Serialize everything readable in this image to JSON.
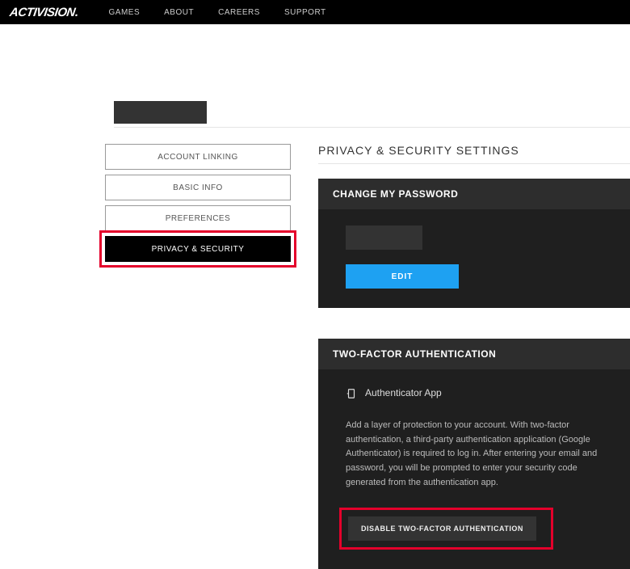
{
  "header": {
    "logo": "ACTIVISION",
    "nav": [
      "GAMES",
      "ABOUT",
      "CAREERS",
      "SUPPORT"
    ]
  },
  "sidenav": {
    "items": [
      {
        "label": "ACCOUNT LINKING",
        "active": false
      },
      {
        "label": "BASIC INFO",
        "active": false
      },
      {
        "label": "PREFERENCES",
        "active": false
      },
      {
        "label": "PRIVACY & SECURITY",
        "active": true
      }
    ]
  },
  "main": {
    "title": "PRIVACY & SECURITY SETTINGS",
    "password_card": {
      "header": "CHANGE MY PASSWORD",
      "edit_label": "EDIT"
    },
    "tfa_card": {
      "header": "TWO-FACTOR AUTHENTICATION",
      "app_label": "Authenticator App",
      "description": "Add a layer of protection to your account. With two-factor authentication, a third-party authentication application (Google Authenticator) is required to log in. After entering your email and password, you will be prompted to enter your security code generated from the authentication app.",
      "disable_label": "DISABLE TWO-FACTOR AUTHENTICATION"
    }
  }
}
